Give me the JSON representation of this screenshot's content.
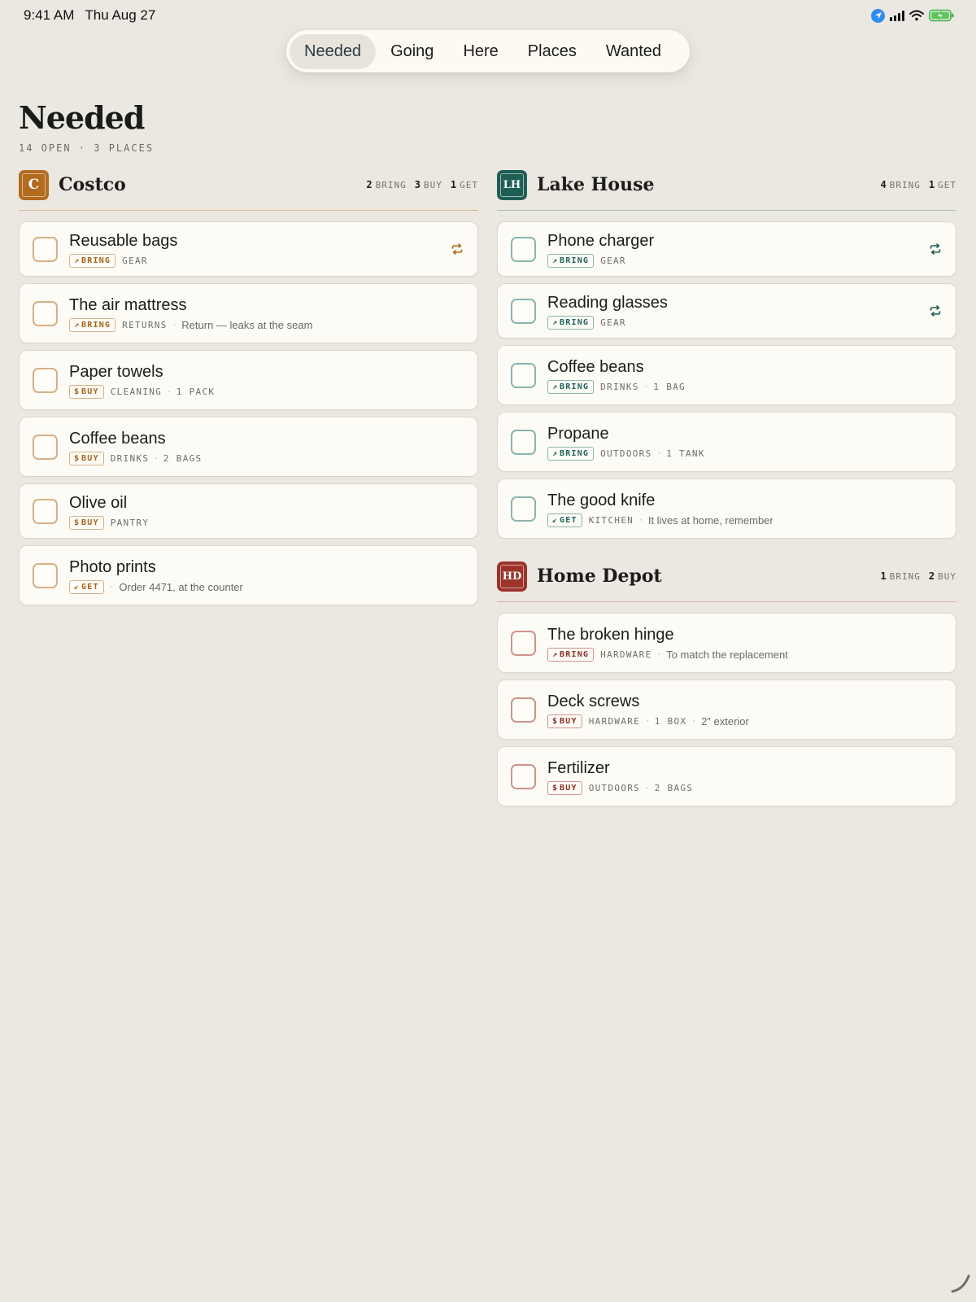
{
  "status": {
    "time": "9:41 AM",
    "date": "Thu Aug 27"
  },
  "tabs": [
    {
      "label": "Needed",
      "active": true
    },
    {
      "label": "Going",
      "active": false
    },
    {
      "label": "Here",
      "active": false
    },
    {
      "label": "Places",
      "active": false
    },
    {
      "label": "Wanted",
      "active": false
    }
  ],
  "page": {
    "title": "Needed",
    "summary": "14 OPEN · 3 PLACES"
  },
  "groups": {
    "costco": {
      "initials": "C",
      "name": "Costco",
      "color": "#b26b1f",
      "stats": [
        {
          "n": "2",
          "label": "BRING"
        },
        {
          "n": "3",
          "label": "BUY"
        },
        {
          "n": "1",
          "label": "GET"
        }
      ],
      "items": [
        {
          "title": "Reusable bags",
          "tag": "BRING",
          "tag_icon": "↗",
          "category": "GEAR",
          "repeat": true
        },
        {
          "title": "The air mattress",
          "tag": "BRING",
          "tag_icon": "↗",
          "category": "RETURNS",
          "note": "Return — leaks at the seam"
        },
        {
          "title": "Paper towels",
          "tag": "BUY",
          "tag_icon": "$",
          "category": "CLEANING",
          "quantity": "1 PACK"
        },
        {
          "title": "Coffee beans",
          "tag": "BUY",
          "tag_icon": "$",
          "category": "DRINKS",
          "quantity": "2 BAGS"
        },
        {
          "title": "Olive oil",
          "tag": "BUY",
          "tag_icon": "$",
          "category": "PANTRY"
        },
        {
          "title": "Photo prints",
          "tag": "GET",
          "tag_icon": "↙",
          "note": "Order 4471, at the counter"
        }
      ]
    },
    "lake": {
      "initials": "LH",
      "name": "Lake House",
      "color": "#1f5e56",
      "stats": [
        {
          "n": "4",
          "label": "BRING"
        },
        {
          "n": "1",
          "label": "GET"
        }
      ],
      "items": [
        {
          "title": "Phone charger",
          "tag": "BRING",
          "tag_icon": "↗",
          "category": "GEAR",
          "repeat": true
        },
        {
          "title": "Reading glasses",
          "tag": "BRING",
          "tag_icon": "↗",
          "category": "GEAR",
          "repeat": true
        },
        {
          "title": "Coffee beans",
          "tag": "BRING",
          "tag_icon": "↗",
          "category": "DRINKS",
          "quantity": "1 BAG"
        },
        {
          "title": "Propane",
          "tag": "BRING",
          "tag_icon": "↗",
          "category": "OUTDOORS",
          "quantity": "1 TANK"
        },
        {
          "title": "The good knife",
          "tag": "GET",
          "tag_icon": "↙",
          "category": "KITCHEN",
          "note": "It lives at home, remember"
        }
      ]
    },
    "depot": {
      "initials": "HD",
      "name": "Home Depot",
      "color": "#9c342b",
      "stats": [
        {
          "n": "1",
          "label": "BRING"
        },
        {
          "n": "2",
          "label": "BUY"
        }
      ],
      "items": [
        {
          "title": "The broken hinge",
          "tag": "BRING",
          "tag_icon": "↗",
          "category": "HARDWARE",
          "note": "To match the replacement"
        },
        {
          "title": "Deck screws",
          "tag": "BUY",
          "tag_icon": "$",
          "category": "HARDWARE",
          "quantity": "1 BOX",
          "note": "2″ exterior"
        },
        {
          "title": "Fertilizer",
          "tag": "BUY",
          "tag_icon": "$",
          "category": "OUTDOORS",
          "quantity": "2 BAGS"
        }
      ]
    }
  }
}
